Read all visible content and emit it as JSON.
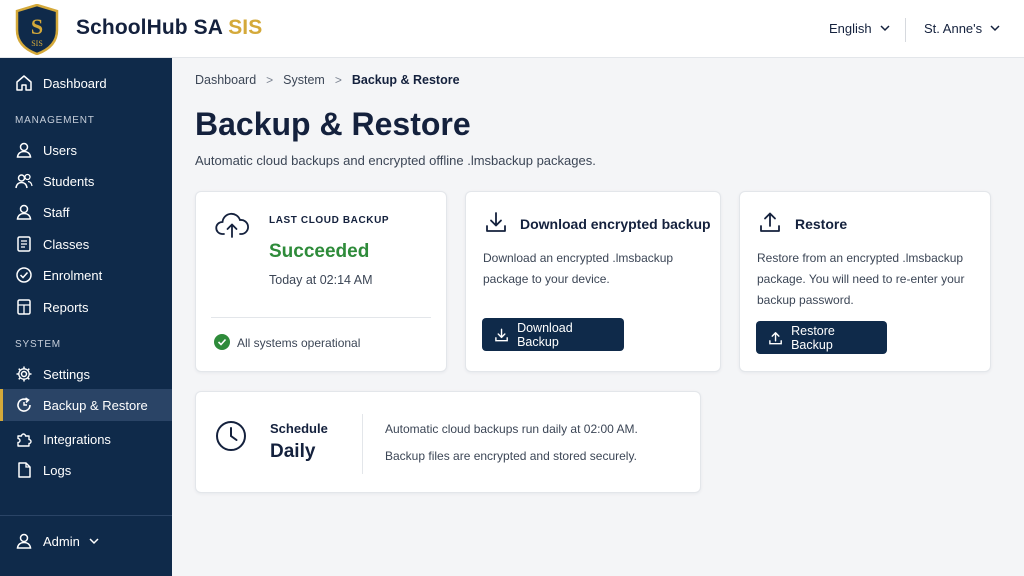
{
  "header": {
    "brand_main": "SchoolHub SA",
    "brand_accent": "SIS",
    "logo_letter": "S",
    "logo_text": "SIS",
    "language": "English",
    "school": "St. Anne's"
  },
  "sidebar": {
    "dashboard": "Dashboard",
    "section_management": "MANAGEMENT",
    "management_items": [
      "Users",
      "Students",
      "Staff",
      "Classes",
      "Enrolment",
      "Reports"
    ],
    "section_system": "SYSTEM",
    "system_items": [
      "Settings",
      "Backup & Restore",
      "Integrations",
      "Logs"
    ],
    "active_item": "Backup & Restore",
    "user": "Admin"
  },
  "breadcrumb": [
    "Dashboard",
    "System",
    "Backup & Restore"
  ],
  "page": {
    "title": "Backup & Restore",
    "subtitle": "Automatic cloud backups and encrypted offline .lmsbackup packages."
  },
  "cloud_card": {
    "label": "LAST CLOUD BACKUP",
    "status": "Succeeded",
    "time": "Today at 02:14 AM",
    "health": "All systems operational"
  },
  "download_card": {
    "title": "Download encrypted backup",
    "description": "Download an encrypted .lmsbackup package to your device.",
    "button": "Download Backup"
  },
  "restore_card": {
    "title": "Restore",
    "description": "Restore from an encrypted .lmsbackup package. You will need to re-enter your backup password.",
    "button": "Restore Backup"
  },
  "schedule_card": {
    "label": "Schedule",
    "value": "Daily",
    "line1": "Automatic cloud backups run daily at 02:00 AM.",
    "line2": "Backup files are encrypted and stored securely."
  },
  "colors": {
    "navy": "#0f2a4a",
    "gold": "#d4a93a",
    "success": "#2e8b3a"
  }
}
